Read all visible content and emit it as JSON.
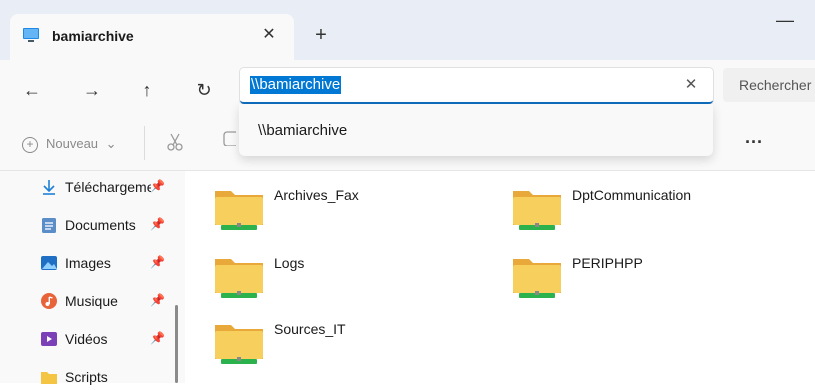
{
  "window": {
    "tab_title": "bamiarchive",
    "tab_close_glyph": "✕",
    "new_tab_glyph": "+",
    "minimize_glyph": "—"
  },
  "nav": {
    "back_glyph": "←",
    "forward_glyph": "→",
    "up_glyph": "↑",
    "refresh_glyph": "↻",
    "address_value": "\\\\bamiarchive",
    "clear_glyph": "✕",
    "search_placeholder": "Rechercher"
  },
  "toolbar": {
    "new_label": "Nouveau",
    "new_chevron": "⌄",
    "more_glyph": "···"
  },
  "suggestion": {
    "text": "\\\\bamiarchive"
  },
  "sidebar": {
    "items": [
      {
        "label": "Téléchargements",
        "icon": "download-icon"
      },
      {
        "label": "Documents",
        "icon": "documents-icon"
      },
      {
        "label": "Images",
        "icon": "images-icon"
      },
      {
        "label": "Musique",
        "icon": "music-icon"
      },
      {
        "label": "Vidéos",
        "icon": "videos-icon"
      },
      {
        "label": "Scripts",
        "icon": "folder-icon"
      }
    ],
    "pin_glyph": "📌"
  },
  "folders": [
    {
      "name": "Archives_Fax"
    },
    {
      "name": "DptCommunication"
    },
    {
      "name": "Logs"
    },
    {
      "name": "PERIPHPP"
    },
    {
      "name": "Sources_IT"
    }
  ],
  "colors": {
    "accent": "#0078d4",
    "folder": "#f4c542",
    "folder_tab": "#e8a93a",
    "network_bar": "#2bb24c"
  }
}
